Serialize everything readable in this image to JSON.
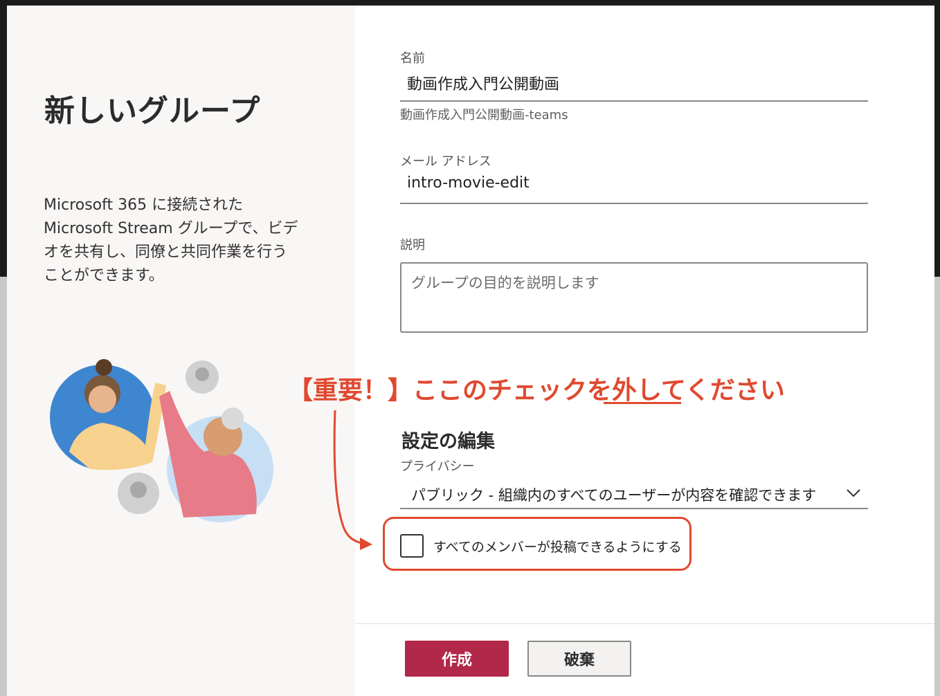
{
  "dialog": {
    "title": "新しいグループ",
    "description": "Microsoft 365 に接続された Microsoft Stream グループで、ビデオを共有し、同僚と共同作業を行うことができます。"
  },
  "form": {
    "name_label": "名前",
    "name_value": "動画作成入門公開動画",
    "name_hint": "動画作成入門公開動画-teams",
    "email_label": "メール アドレス",
    "email_value": "intro-movie-edit",
    "description_label": "説明",
    "description_placeholder": "グループの目的を説明します",
    "settings_title": "設定の編集",
    "privacy_label": "プライバシー",
    "privacy_value": "パブリック - 組織内のすべてのユーザーが内容を確認できます",
    "checkbox_label": "すべてのメンバーが投稿できるようにする",
    "checkbox_checked": false
  },
  "annotation": {
    "text": "【重要！】ここのチェックを外してください",
    "color": "#e0492f"
  },
  "buttons": {
    "create": "作成",
    "discard": "破棄"
  },
  "colors": {
    "primary": "#b1284a",
    "left_pane": "#f8f7f6"
  }
}
